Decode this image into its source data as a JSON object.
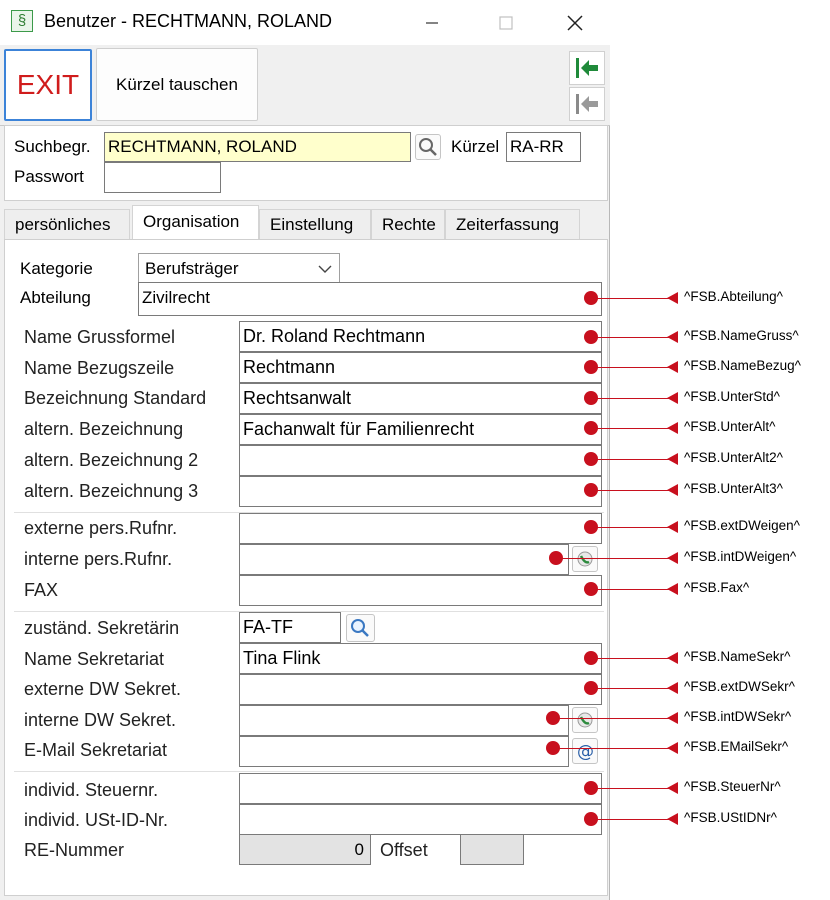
{
  "window": {
    "title": "Benutzer - RECHTMANN, ROLAND",
    "app_icon": "§"
  },
  "toolbar": {
    "exit_label": "EXIT",
    "swap_label": "Kürzel tauschen"
  },
  "header": {
    "suchbegr_label": "Suchbegr.",
    "suchbegr_value": "RECHTMANN, ROLAND",
    "kuerzel_label": "Kürzel",
    "kuerzel_value": "RA-RR",
    "passwort_label": "Passwort",
    "passwort_value": ""
  },
  "tabs": [
    "persönliches",
    "Organisation",
    "Einstellung",
    "Rechte",
    "Zeiterfassung"
  ],
  "form": {
    "kategorie_label": "Kategorie",
    "kategorie_value": "Berufsträger",
    "abteilung_label": "Abteilung",
    "abteilung_value": "Zivilrecht",
    "namegruss_label": "Name Grussformel",
    "namegruss_value": "Dr. Roland Rechtmann",
    "namebezug_label": "Name Bezugszeile",
    "namebezug_value": "Rechtmann",
    "unterstd_label": "Bezeichnung Standard",
    "unterstd_value": "Rechtsanwalt",
    "unteralt_label": "altern. Bezeichnung",
    "unteralt_value": "Fachanwalt für Familienrecht",
    "unteralt2_label": "altern. Bezeichnung 2",
    "unteralt2_value": "",
    "unteralt3_label": "altern. Bezeichnung 3",
    "unteralt3_value": "",
    "extdw_label": "externe pers.Rufnr.",
    "extdw_value": "",
    "intdw_label": "interne pers.Rufnr.",
    "intdw_value": "",
    "fax_label": "FAX",
    "fax_value": "",
    "sekr_label": "zuständ. Sekretärin",
    "sekr_value": "FA-TF",
    "namesekr_label": "Name Sekretariat",
    "namesekr_value": "Tina Flink",
    "extdwsekr_label": "externe DW Sekret.",
    "extdwsekr_value": "",
    "intdwsekr_label": "interne DW Sekret.",
    "intdwsekr_value": "",
    "emailsekr_label": "E-Mail Sekretariat",
    "emailsekr_value": "",
    "steuernr_label": "individ. Steuernr.",
    "steuernr_value": "",
    "ustid_label": "individ. USt-ID-Nr.",
    "ustid_value": "",
    "renummer_label": "RE-Nummer",
    "renummer_value": "0",
    "offset_label": "Offset",
    "offset_value": ""
  },
  "annotations": {
    "abteilung": "^FSB.Abteilung^",
    "namegruss": "^FSB.NameGruss^",
    "namebezug": "^FSB.NameBezug^",
    "unterstd": "^FSB.UnterStd^",
    "unteralt": "^FSB.UnterAlt^",
    "unteralt2": "^FSB.UnterAlt2^",
    "unteralt3": "^FSB.UnterAlt3^",
    "extdw": "^FSB.extDWeigen^",
    "intdw": "^FSB.intDWeigen^",
    "fax": "^FSB.Fax^",
    "namesekr": "^FSB.NameSekr^",
    "extdwsekr": "^FSB.extDWSekr^",
    "intdwsekr": "^FSB.intDWSekr^",
    "emailsekr": "^FSB.EMailSekr^",
    "steuernr": "^FSB.SteuerNr^",
    "ustid": "^FSB.UStIDNr^"
  },
  "colors": {
    "annotation_red": "#c8101e",
    "exit_red": "#d01c1c",
    "field_yellow": "#ffffcc",
    "focus_blue": "#3c83d8"
  }
}
